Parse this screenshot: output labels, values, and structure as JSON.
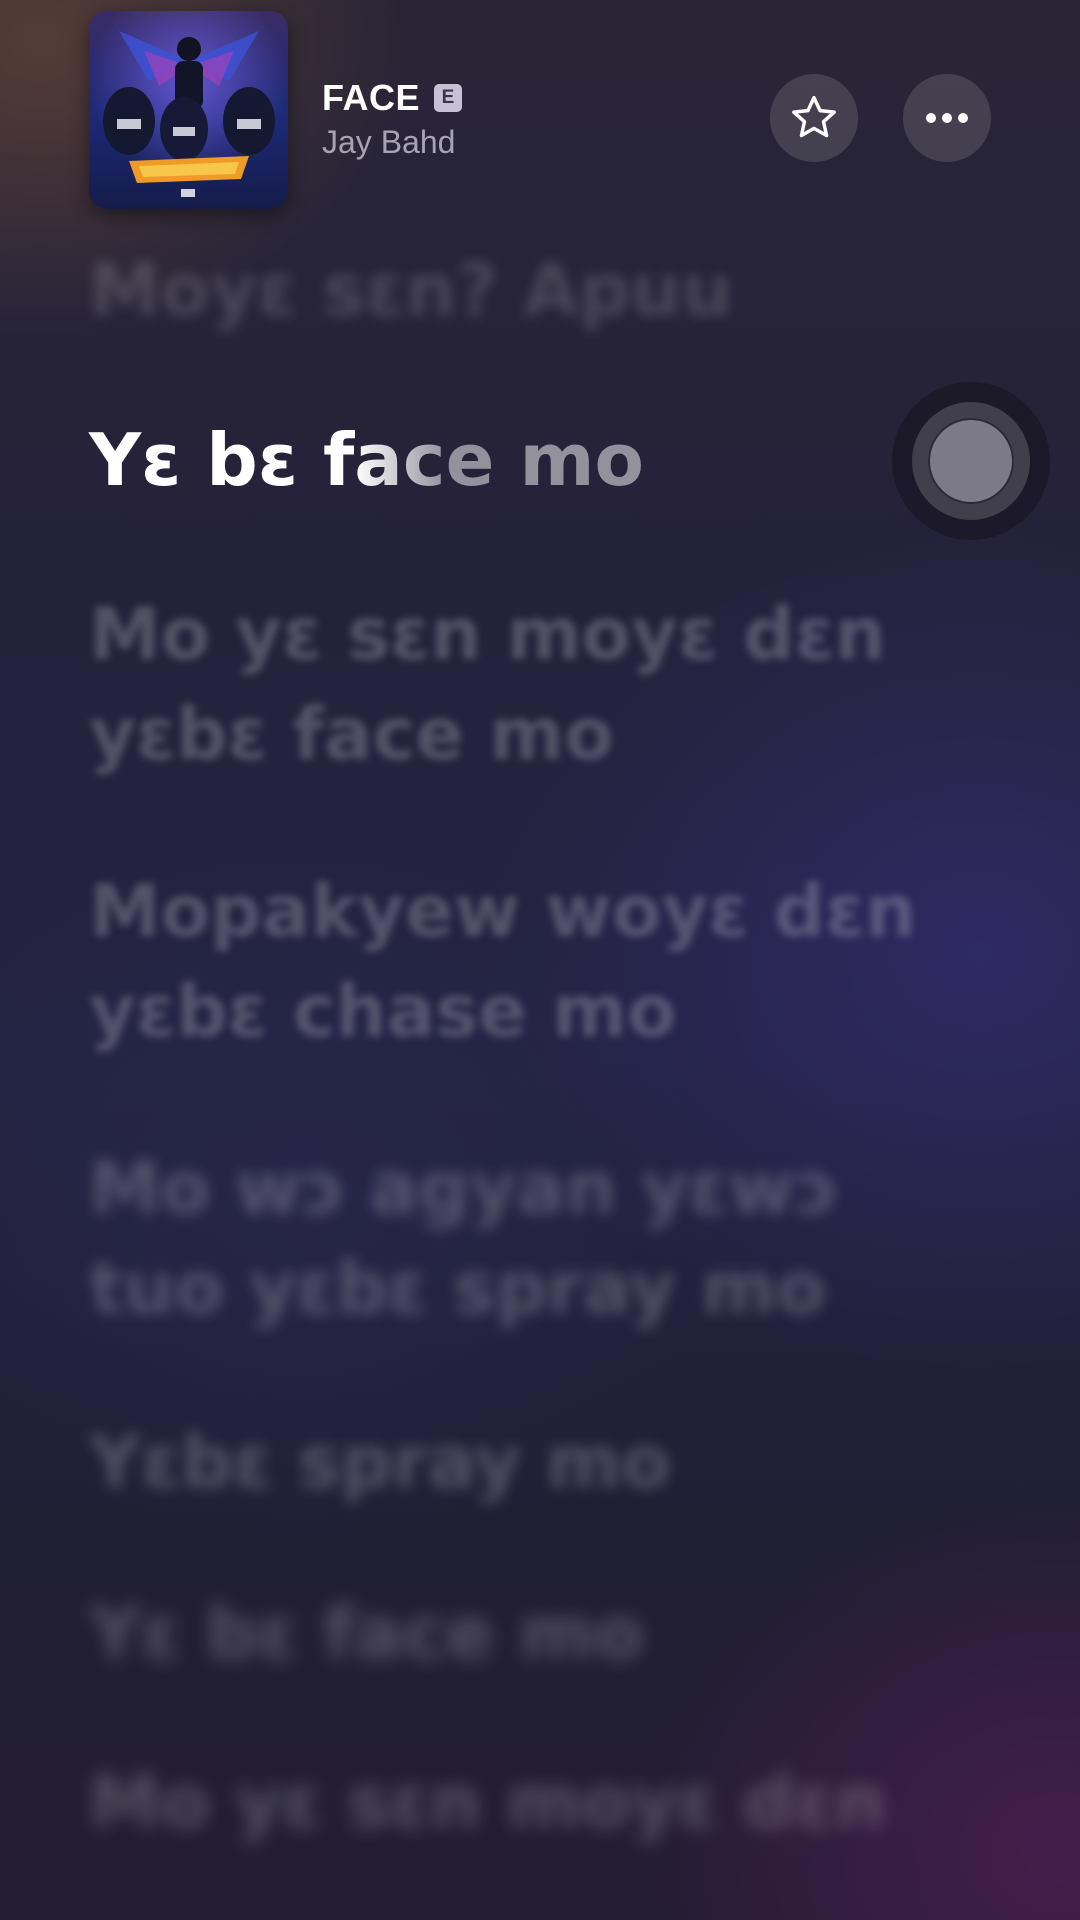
{
  "header": {
    "title": "FACE",
    "explicit_badge": "E",
    "artist": "Jay Bahd",
    "album_art_icon": "album-cover-art",
    "favorite_icon": "star-outline-icon",
    "more_icon": "ellipsis-icon"
  },
  "lyrics": {
    "previous": "Moyɛ sɛn? Apuu",
    "current_sung": "Yɛ bɛ f",
    "current_singing": "ac",
    "current_rest": "e mo",
    "upcoming": [
      "Mo yɛ sɛn moyɛ dɛn yɛbɛ face mo",
      "Mopakyew woyɛ dɛn yɛbɛ chase mo",
      "Mo wɔ agyan yɛwɔ tuo yɛbɛ spray mo",
      "Yɛbɛ spray mo",
      "Yɛ bɛ face mo",
      "Mo yɛ sɛn moyɛ dɛn"
    ]
  },
  "colors": {
    "background_top": "#2a2536",
    "background_bottom": "#241d33",
    "explicit_badge_bg": "#c9c0d6",
    "active_lyric": "#ffffff"
  }
}
